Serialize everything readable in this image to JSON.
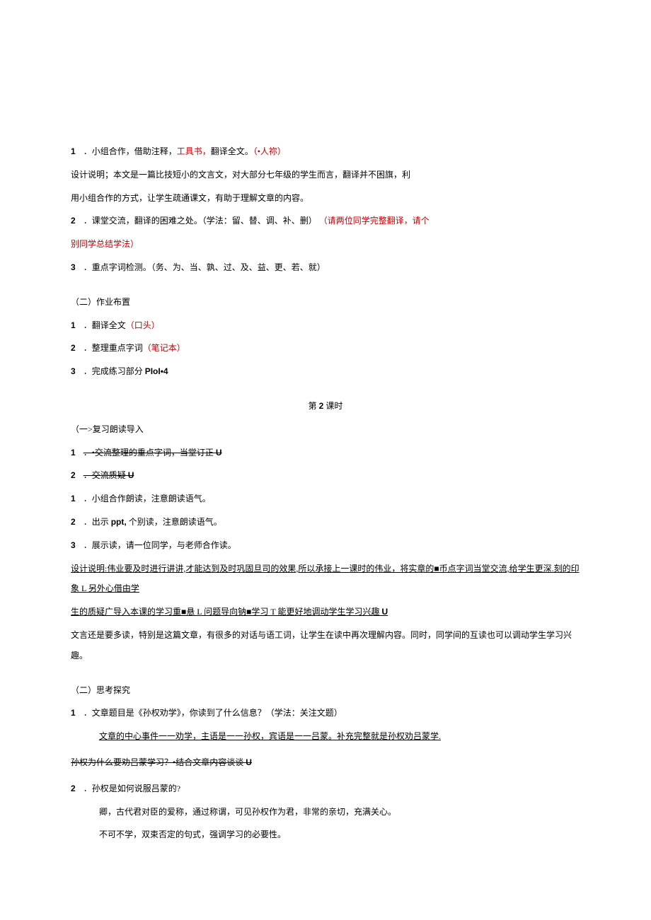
{
  "p1_num": "1",
  "p1_a": "．小组合作，借助注释，",
  "p1_b": "工具书，",
  "p1_c": "翻译全文。",
  "p1_d": "（•人祢）",
  "p2": "设计说明；本文是一篇比技短小的文言文，对大部分七年级的学生而言，翻译并不困旗，利",
  "p3": "用小组合作的方式，让学生疏通课文，有助于理解文章的内容。",
  "p4_num": "2",
  "p4_a": "．课堂交流，翻译的困难之处。（学法：留、替、调、补、删）",
  "p4_b": "（请两位同学完整翻译，请个",
  "p5": "别同学总结学法）",
  "p6_num": "3",
  "p6_a": "．重点字词检测。（务、为、当、孰、过、及、益、更、若、就）",
  "h1": "（二）作业布置",
  "a1_num": "1",
  "a1_a": "．翻译全文",
  "a1_b": "（口头）",
  "a2_num": "2",
  "a2_a": "．整理重点字词",
  "a2_b": "（笔记本）",
  "a3_num": "3",
  "a3_a": "．完成练习部分 ",
  "a3_b": "PIoI•4",
  "h2_a": "第 ",
  "h2_b": "2",
  "h2_c": " 课时",
  "r1": "（一>复习朗读导入",
  "r2_num": "1",
  "r2_a": "．•交流整理的重点字词，当堂订正 ",
  "r2_b": "U",
  "r3_num": "2",
  "r3_a": "．交流质疑 ",
  "r3_b": "U",
  "r4_num": "1",
  "r4_a": "．小组合作朗读，注意朗读语气。",
  "r5_num": "2",
  "r5_a": "．出示 ",
  "r5_b": "ppt,",
  "r5_c": " 个别读，注意朗读语气。",
  "r6_num": "3",
  "r6_a": "．展示读，请一位同学，与老师合作读。",
  "d1": "设计说明:伟业要及时进行讲讲,才能达到及时巩固旦司的效果,所以承接上一课时的伟业，将实章的■币点字词当堂交流,给学生更深.刻的印象 L 另外心借由学",
  "d2_a": "生的质疑广导入本课的学习重■悬 L 问题导向钠■学习 T 能更好地调动学生学习兴趣 ",
  "d2_b": "U",
  "d3": "文言还是要多读，特别是这篇文章，有很多的对话与语工词，让学生在读中再次理解内容。同时，同学间的互读也可以调动学生学习兴趣。",
  "h3": "（二）思考探究",
  "q1_num": "1",
  "q1_a": "．文章题目是《孙权劝学》，你读到了什么信息？（学法：关注文题）",
  "q1b": "文章的中心事件一一劝学，主语是一一孙权，宾语是一一吕蒙。补充完整就是孙权劝吕蒙学.",
  "q2_a": "孙权为什么要劝吕蒙学习？•结合文章内容谈谈 ",
  "q2_b": "U",
  "q3_num": "2",
  "q3_a": "．孙权是如何说服吕蒙的?",
  "q3b": "卿，古代君对臣的爱称，通过称谓，可见孙权作为君，非常的亲切，充满关心。",
  "q3c": "不可不学，双束否定的句式，强调学习的必要性。"
}
